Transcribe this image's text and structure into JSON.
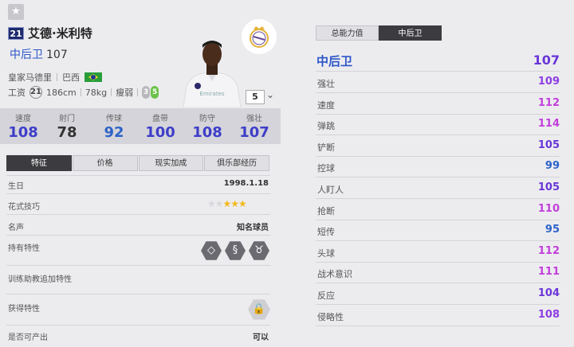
{
  "player": {
    "ovr_season": "21",
    "name": "艾德·米利特",
    "position": "中后卫",
    "rating": "107",
    "club": "皇家马德里",
    "nation": "巴西",
    "wage_label": "工资",
    "wage": "21",
    "height": "186cm",
    "weight": "78kg",
    "body": "瘦弱",
    "weak_foot_left": "3",
    "weak_foot_right": "5",
    "level": "5"
  },
  "stats": [
    {
      "label": "速度",
      "value": "108",
      "color": "#3e3ec8"
    },
    {
      "label": "射门",
      "value": "78",
      "color": "#333333"
    },
    {
      "label": "传球",
      "value": "92",
      "color": "#2e63c8"
    },
    {
      "label": "盘带",
      "value": "100",
      "color": "#3e3ec8"
    },
    {
      "label": "防守",
      "value": "108",
      "color": "#3e3ec8"
    },
    {
      "label": "强壮",
      "value": "107",
      "color": "#3e3ec8"
    }
  ],
  "tabs": [
    "特征",
    "价格",
    "现实加成",
    "俱乐部经历"
  ],
  "details": {
    "birthday_label": "生日",
    "birthday": "1998.1.18",
    "skill_label": "花式技巧",
    "skill_stars": "★★★★★",
    "reputation_label": "名声",
    "reputation": "知名球员",
    "traits_label": "持有特性",
    "coach_label": "训练助教追加特性",
    "acquired_label": "获得特性",
    "tradable_label": "是否可产出",
    "tradable": "可以"
  },
  "trait_icons": [
    "diamond-icon",
    "snake-icon",
    "bull-icon"
  ],
  "right": {
    "tabs": [
      "总能力值",
      "中后卫"
    ],
    "head_label": "中后卫",
    "head_value": "107",
    "attributes": [
      {
        "label": "强壮",
        "value": "109",
        "color": "#8e3ee0"
      },
      {
        "label": "速度",
        "value": "112",
        "color": "#c23edb"
      },
      {
        "label": "弹跳",
        "value": "114",
        "color": "#c23edb"
      },
      {
        "label": "铲断",
        "value": "105",
        "color": "#6a36d8"
      },
      {
        "label": "控球",
        "value": "99",
        "color": "#2e63c8"
      },
      {
        "label": "人盯人",
        "value": "105",
        "color": "#6a36d8"
      },
      {
        "label": "抢断",
        "value": "110",
        "color": "#c23edb"
      },
      {
        "label": "短传",
        "value": "95",
        "color": "#2e63c8"
      },
      {
        "label": "头球",
        "value": "112",
        "color": "#c23edb"
      },
      {
        "label": "战术意识",
        "value": "111",
        "color": "#c23edb"
      },
      {
        "label": "反应",
        "value": "104",
        "color": "#6a36d8"
      },
      {
        "label": "侵略性",
        "value": "108",
        "color": "#8e3ee0"
      }
    ]
  }
}
